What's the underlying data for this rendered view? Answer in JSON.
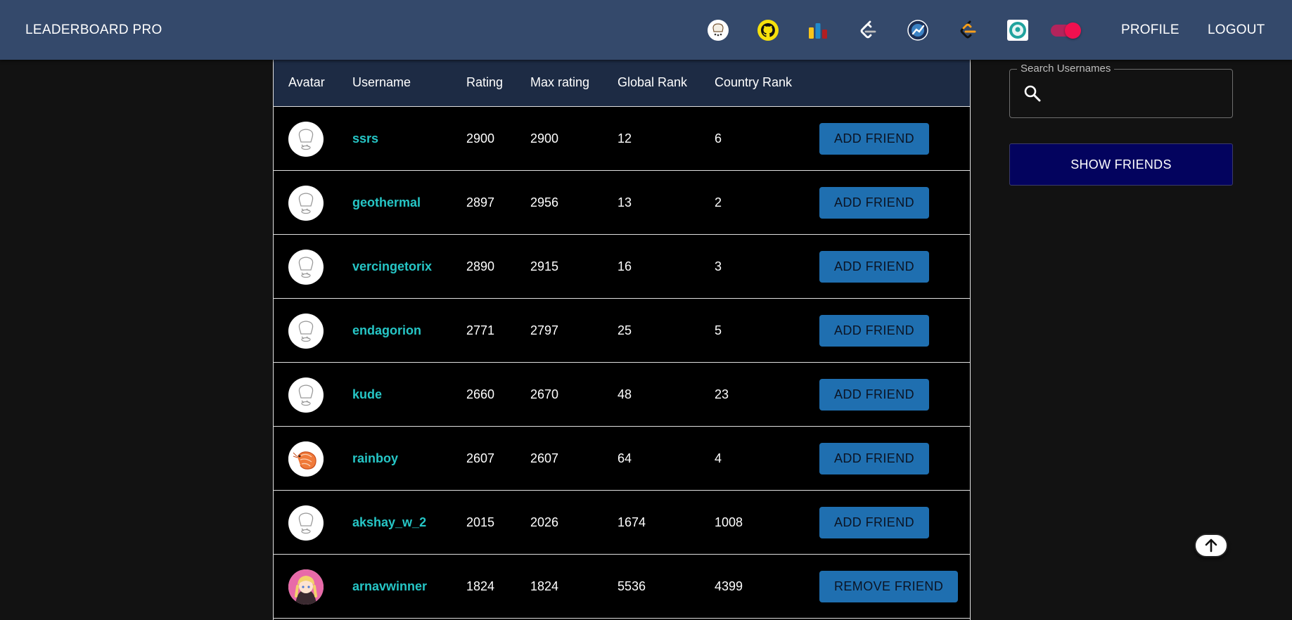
{
  "app": {
    "title": "LEADERBOARD PRO"
  },
  "header": {
    "platform_icons": [
      "codechef-icon",
      "github-icon",
      "codeforces-icon",
      "leetcode-icon",
      "atcoder-icon",
      "leetcode-alt-icon",
      "lightoj-icon"
    ],
    "theme_toggle": {
      "on": true
    },
    "nav": {
      "profile": "PROFILE",
      "logout": "LOGOUT"
    }
  },
  "table": {
    "columns": [
      "Avatar",
      "Username",
      "Rating",
      "Max rating",
      "Global Rank",
      "Country Rank"
    ],
    "rows": [
      {
        "avatar": "chef-hat-avatar",
        "username": "ssrs",
        "rating": "2900",
        "max_rating": "2900",
        "global_rank": "12",
        "country_rank": "6",
        "action": "ADD FRIEND"
      },
      {
        "avatar": "chef-hat-avatar",
        "username": "geothermal",
        "rating": "2897",
        "max_rating": "2956",
        "global_rank": "13",
        "country_rank": "2",
        "action": "ADD FRIEND"
      },
      {
        "avatar": "chef-hat-avatar",
        "username": "vercingetorix",
        "rating": "2890",
        "max_rating": "2915",
        "global_rank": "16",
        "country_rank": "3",
        "action": "ADD FRIEND"
      },
      {
        "avatar": "chef-hat-avatar",
        "username": "endagorion",
        "rating": "2771",
        "max_rating": "2797",
        "global_rank": "25",
        "country_rank": "5",
        "action": "ADD FRIEND"
      },
      {
        "avatar": "chef-hat-avatar",
        "username": "kude",
        "rating": "2660",
        "max_rating": "2670",
        "global_rank": "48",
        "country_rank": "23",
        "action": "ADD FRIEND"
      },
      {
        "avatar": "shrimp-avatar",
        "username": "rainboy",
        "rating": "2607",
        "max_rating": "2607",
        "global_rank": "64",
        "country_rank": "4",
        "action": "ADD FRIEND"
      },
      {
        "avatar": "chef-hat-avatar",
        "username": "akshay_w_2",
        "rating": "2015",
        "max_rating": "2026",
        "global_rank": "1674",
        "country_rank": "1008",
        "action": "ADD FRIEND"
      },
      {
        "avatar": "anime-girl-avatar",
        "username": "arnavwinner",
        "rating": "1824",
        "max_rating": "1824",
        "global_rank": "5536",
        "country_rank": "4399",
        "action": "REMOVE FRIEND"
      }
    ]
  },
  "search": {
    "label": "Search Usernames",
    "value": ""
  },
  "show_friends_label": "SHOW FRIENDS",
  "colors": {
    "appbar": "#34496b",
    "username": "#26c6c6",
    "button": "#1f6fb0",
    "show_friends": "#03035e",
    "toggle": "#f0104f"
  }
}
